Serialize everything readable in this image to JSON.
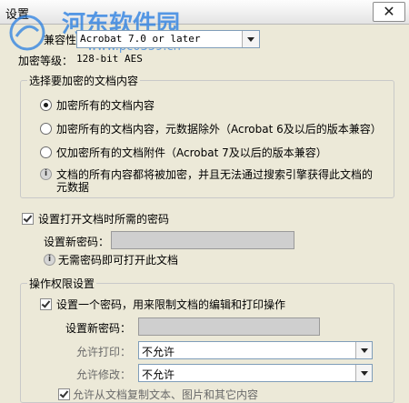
{
  "window": {
    "title": "设置",
    "close_label": "✕"
  },
  "watermark": {
    "text": "河东软件园",
    "url": "www.pc0359.cn"
  },
  "compat": {
    "label": "兼容性：",
    "value": "Acrobat 7.0 or later"
  },
  "encryption_level": {
    "label": "加密等级：",
    "value": "128-bit AES"
  },
  "encrypt_group": {
    "title": "选择要加密的文档内容",
    "options": [
      {
        "label": "加密所有的文档内容",
        "selected": true
      },
      {
        "label": "加密所有的文档内容，元数据除外（Acrobat 6及以后的版本兼容）",
        "selected": false
      },
      {
        "label": "仅加密所有的文档附件（Acrobat 7及以后的版本兼容）",
        "selected": false
      }
    ],
    "info_line1": "文档的所有内容都将被加密，并且无法通过搜索引擎获得此文档的",
    "info_line2": "元数据"
  },
  "open_password": {
    "checkbox_label": "设置打开文档时所需的密码",
    "checked": true,
    "field_label": "设置新密码：",
    "info": "无需密码即可打开此文档"
  },
  "permissions_group": {
    "title": "操作权限设置",
    "checkbox_label": "设置一个密码，用来限制文档的编辑和打印操作",
    "checked": true,
    "field_label": "设置新密码：",
    "print_label": "允许打印：",
    "print_value": "不允许",
    "edit_label": "允许修改：",
    "edit_value": "不允许",
    "copy_label_partial": "允许从文档复制文本、图片和其它内容"
  }
}
